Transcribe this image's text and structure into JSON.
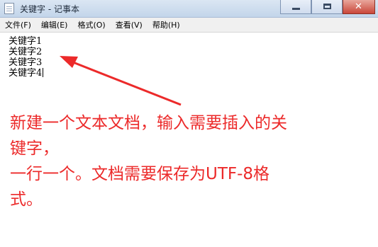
{
  "window": {
    "title": "关键字 - 记事本",
    "controls": {
      "minimize": "minimize",
      "maximize": "maximize",
      "close": "close"
    }
  },
  "menu": [
    {
      "label": "文件(F)"
    },
    {
      "label": "编辑(E)"
    },
    {
      "label": "格式(O)"
    },
    {
      "label": "查看(V)"
    },
    {
      "label": "帮助(H)"
    }
  ],
  "editor": {
    "lines": [
      "关键字1",
      "关键字2",
      "关键字3",
      "关键字4"
    ]
  },
  "annotation": {
    "lines": [
      "新建一个文本文档，输入需要插入的关",
      "键字，",
      "一行一个。文档需要保存为UTF-8格",
      "式。"
    ],
    "color": "#ec2a2a"
  }
}
